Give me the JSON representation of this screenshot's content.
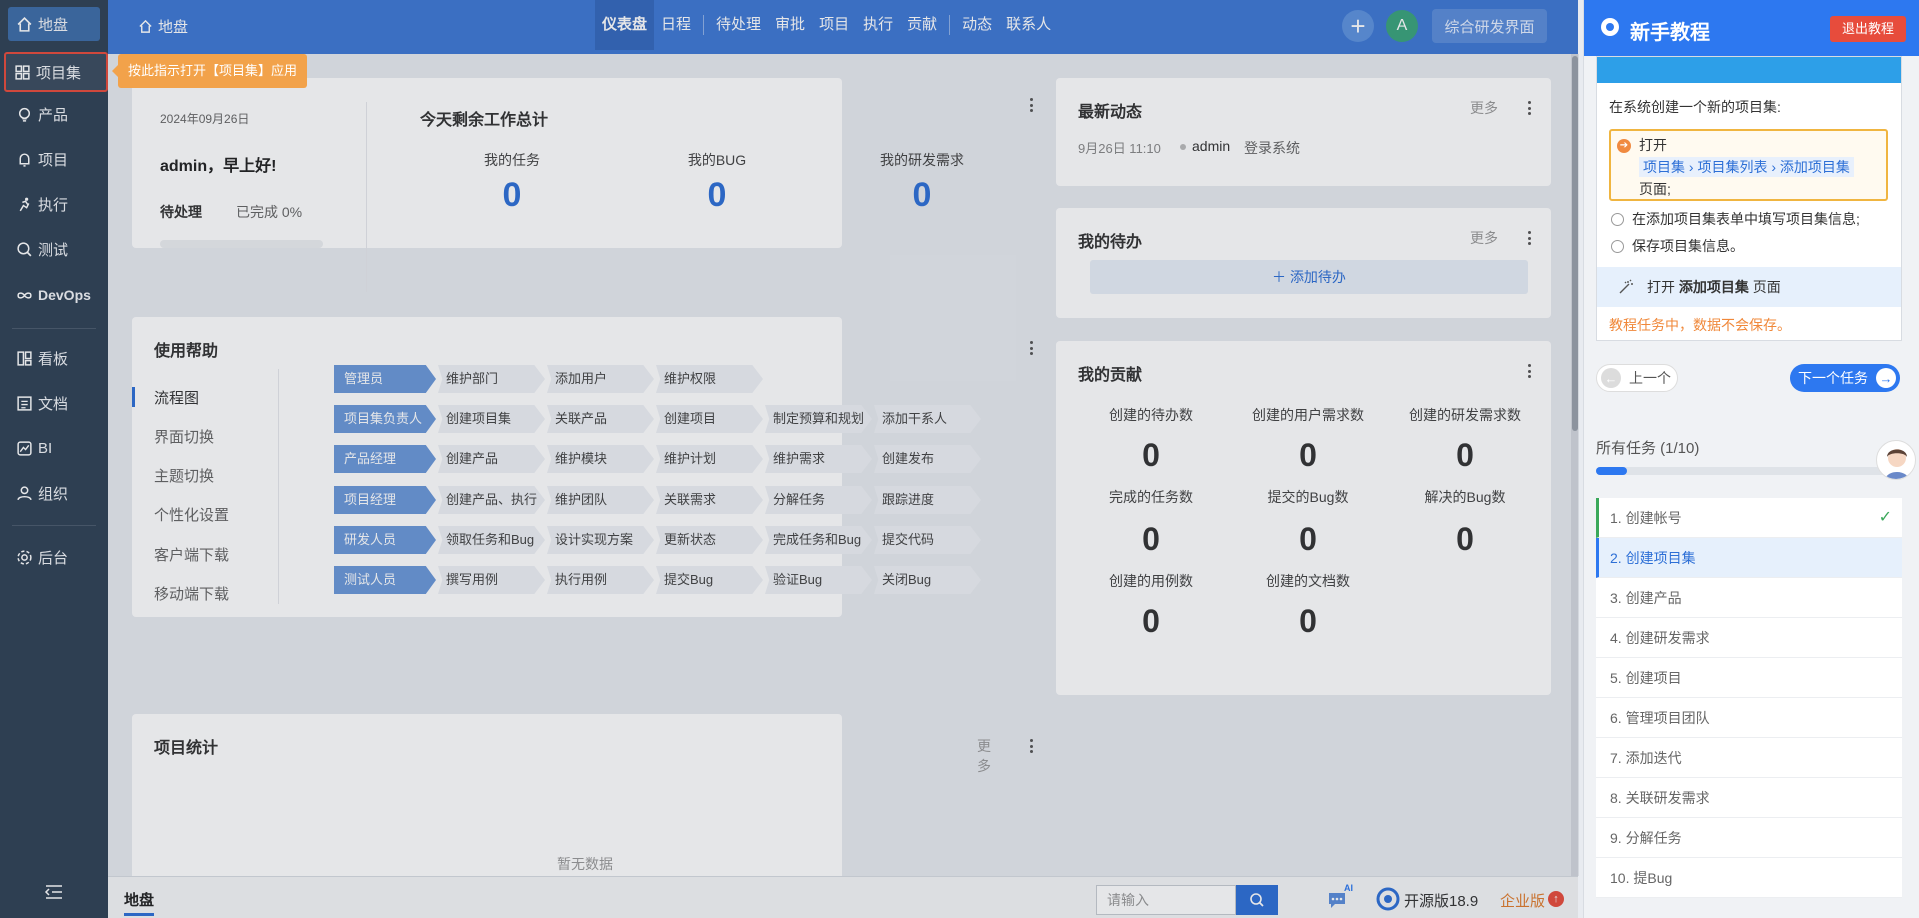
{
  "sidebar": {
    "items": [
      {
        "label": "地盘",
        "icon": "home-icon"
      },
      {
        "label": "项目集",
        "icon": "grid-icon"
      },
      {
        "label": "产品",
        "icon": "lightbulb-icon"
      },
      {
        "label": "项目",
        "icon": "bell-icon"
      },
      {
        "label": "执行",
        "icon": "run-icon"
      },
      {
        "label": "测试",
        "icon": "magnifier-icon"
      },
      {
        "label": "DevOps",
        "icon": "infinity-icon"
      },
      {
        "label": "看板",
        "icon": "board-icon"
      },
      {
        "label": "文档",
        "icon": "doc-icon"
      },
      {
        "label": "BI",
        "icon": "chart-icon"
      },
      {
        "label": "组织",
        "icon": "user-icon"
      },
      {
        "label": "后台",
        "icon": "gear-icon"
      }
    ]
  },
  "tooltip": "按此指示打开【项目集】应用",
  "header": {
    "breadcrumb": "地盘",
    "nav": [
      "仪表盘",
      "日程",
      "待处理",
      "审批",
      "项目",
      "执行",
      "贡献",
      "动态",
      "联系人"
    ],
    "avatar_letter": "A",
    "rd_button": "综合研发界面"
  },
  "welcome": {
    "date": "2024年09月26日",
    "greeting": "admin，早上好!",
    "pending_label": "待处理",
    "done_label": "已完成 0%",
    "done_fraction": 0,
    "summary_title": "今天剩余工作总计",
    "stats": [
      {
        "label": "我的任务",
        "value": "0"
      },
      {
        "label": "我的BUG",
        "value": "0"
      },
      {
        "label": "我的研发需求",
        "value": "0"
      }
    ]
  },
  "dynamics": {
    "title": "最新动态",
    "more": "更多",
    "entry_time": "9月26日 11:10",
    "entry_user": "admin",
    "entry_action": "登录系统"
  },
  "todo": {
    "title": "我的待办",
    "more": "更多",
    "add_label": "添加待办"
  },
  "help": {
    "title": "使用帮助",
    "tabs": [
      "流程图",
      "界面切换",
      "主题切换",
      "个性化设置",
      "客户端下载",
      "移动端下载"
    ],
    "flow": [
      {
        "role": "管理员",
        "steps": [
          "维护部门",
          "添加用户",
          "维护权限"
        ]
      },
      {
        "role": "项目集负责人",
        "steps": [
          "创建项目集",
          "关联产品",
          "创建项目",
          "制定预算和规划",
          "添加干系人"
        ]
      },
      {
        "role": "产品经理",
        "steps": [
          "创建产品",
          "维护模块",
          "维护计划",
          "维护需求",
          "创建发布"
        ]
      },
      {
        "role": "项目经理",
        "steps": [
          "创建产品、执行",
          "维护团队",
          "关联需求",
          "分解任务",
          "跟踪进度"
        ]
      },
      {
        "role": "研发人员",
        "steps": [
          "领取任务和Bug",
          "设计实现方案",
          "更新状态",
          "完成任务和Bug",
          "提交代码"
        ]
      },
      {
        "role": "测试人员",
        "steps": [
          "撰写用例",
          "执行用例",
          "提交Bug",
          "验证Bug",
          "关闭Bug"
        ]
      }
    ]
  },
  "contrib": {
    "title": "我的贡献",
    "items": [
      {
        "label": "创建的待办数",
        "value": "0"
      },
      {
        "label": "创建的用户需求数",
        "value": "0"
      },
      {
        "label": "创建的研发需求数",
        "value": "0"
      },
      {
        "label": "完成的任务数",
        "value": "0"
      },
      {
        "label": "提交的Bug数",
        "value": "0"
      },
      {
        "label": "解决的Bug数",
        "value": "0"
      },
      {
        "label": "创建的用例数",
        "value": "0"
      },
      {
        "label": "创建的文档数",
        "value": "0"
      }
    ]
  },
  "projstats": {
    "title": "项目统计",
    "more": "更多",
    "empty": "暂无数据"
  },
  "footer": {
    "tab": "地盘",
    "search_placeholder": "请输入",
    "ai_badge": "AI",
    "version": "开源版18.9",
    "enterprise": "企业版",
    "enterprise_badge": "↑"
  },
  "tutorial": {
    "title": "新手教程",
    "exit": "退出教程",
    "task_desc": "在系统创建一个新的项目集:",
    "step_open": "打开",
    "step_path": "项目集 › 项目集列表 › 添加项目集",
    "step_page": "页面;",
    "step2": "在添加项目集表单中填写项目集信息;",
    "step3": "保存项目集信息。",
    "open_hint_pre": "打开",
    "open_hint_bold": "添加项目集",
    "open_hint_post": "页面",
    "warning": "教程任务中，数据不会保存。",
    "prev": "上一个",
    "next": "下一个任务",
    "all_tasks": "所有任务 (1/10)",
    "progress": 0.1,
    "tasks": [
      "1. 创建帐号",
      "2. 创建项目集",
      "3. 创建产品",
      "4. 创建研发需求",
      "5. 创建项目",
      "6. 管理项目团队",
      "7. 添加迭代",
      "8. 关联研发需求",
      "9. 分解任务",
      "10. 提Bug"
    ]
  },
  "colors": {
    "header": "#3e78d4",
    "sidebar": "#2f4155",
    "accent": "#2d78f0",
    "tooltip": "#f2a24a"
  }
}
